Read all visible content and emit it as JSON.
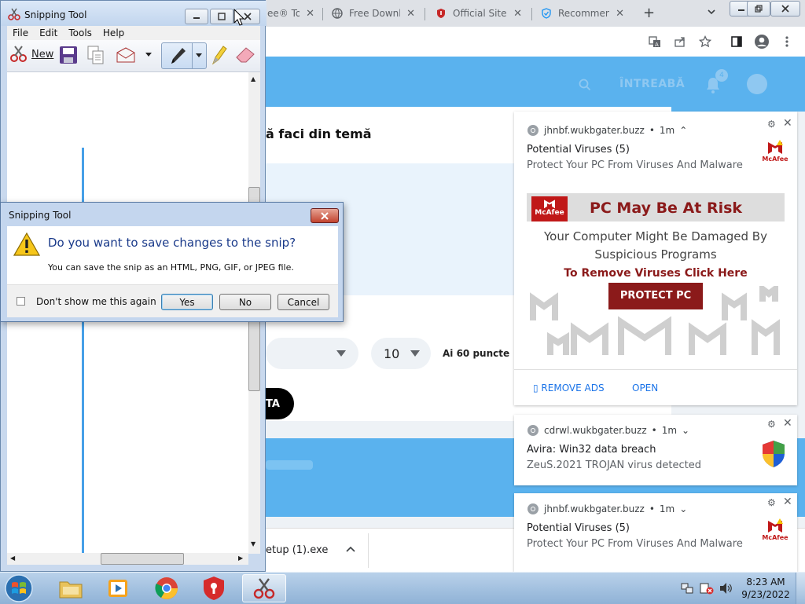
{
  "browser": {
    "tabs": [
      {
        "label": "ee® To"
      },
      {
        "label": "Free Downlo"
      },
      {
        "label": "Official Site"
      },
      {
        "label": "Recommend"
      }
    ],
    "new_tab": "+",
    "page": {
      "ask_label": "ÎNTREABĂ",
      "notif_count": "4",
      "task_text": "ă faci din temă",
      "select_value": "10",
      "points_text": "Ai 60 puncte",
      "black_button_label": "TA",
      "download_file": "etup (1).exe"
    }
  },
  "notifications": [
    {
      "site": "jhnbf.wukbgater.buzz",
      "age": "1m",
      "title": "Potential Viruses (5)",
      "body": "Protect Your PC From Viruses And Malware",
      "brand": "McAfee",
      "ad": {
        "logo_text": "McAfee",
        "headline": "PC May Be At Risk",
        "line1": "Your Computer Might Be Damaged By",
        "line2": "Suspicious Programs",
        "cta_text": "To Remove Viruses Click Here",
        "button": "PROTECT PC"
      },
      "actions": [
        "REMOVE ADS",
        "OPEN"
      ]
    },
    {
      "site": "cdrwl.wukbgater.buzz",
      "age": "1m",
      "title": "Avira: Win32 data breach",
      "body": "ZeuS.2021 TROJAN virus detected"
    },
    {
      "site": "jhnbf.wukbgater.buzz",
      "age": "1m",
      "title": "Potential Viruses (5)",
      "body": "Protect Your PC From Viruses And Malware",
      "brand": "McAfee"
    }
  ],
  "snipping_tool": {
    "title": "Snipping Tool",
    "menu": [
      "File",
      "Edit",
      "Tools",
      "Help"
    ],
    "new_label": "New"
  },
  "dialog": {
    "title": "Snipping Tool",
    "question": "Do you want to save changes to the snip?",
    "detail": "You can save the snip as an HTML, PNG, GIF, or JPEG file.",
    "checkbox_label": "Don't show me this again",
    "buttons": {
      "yes": "Yes",
      "no": "No",
      "cancel": "Cancel"
    }
  },
  "taskbar": {
    "time": "8:23 AM",
    "date": "9/23/2022"
  },
  "colors": {
    "page_blue": "#5ab2ee",
    "mcafee_red": "#c01818",
    "protect_btn": "#8b1a1a"
  }
}
